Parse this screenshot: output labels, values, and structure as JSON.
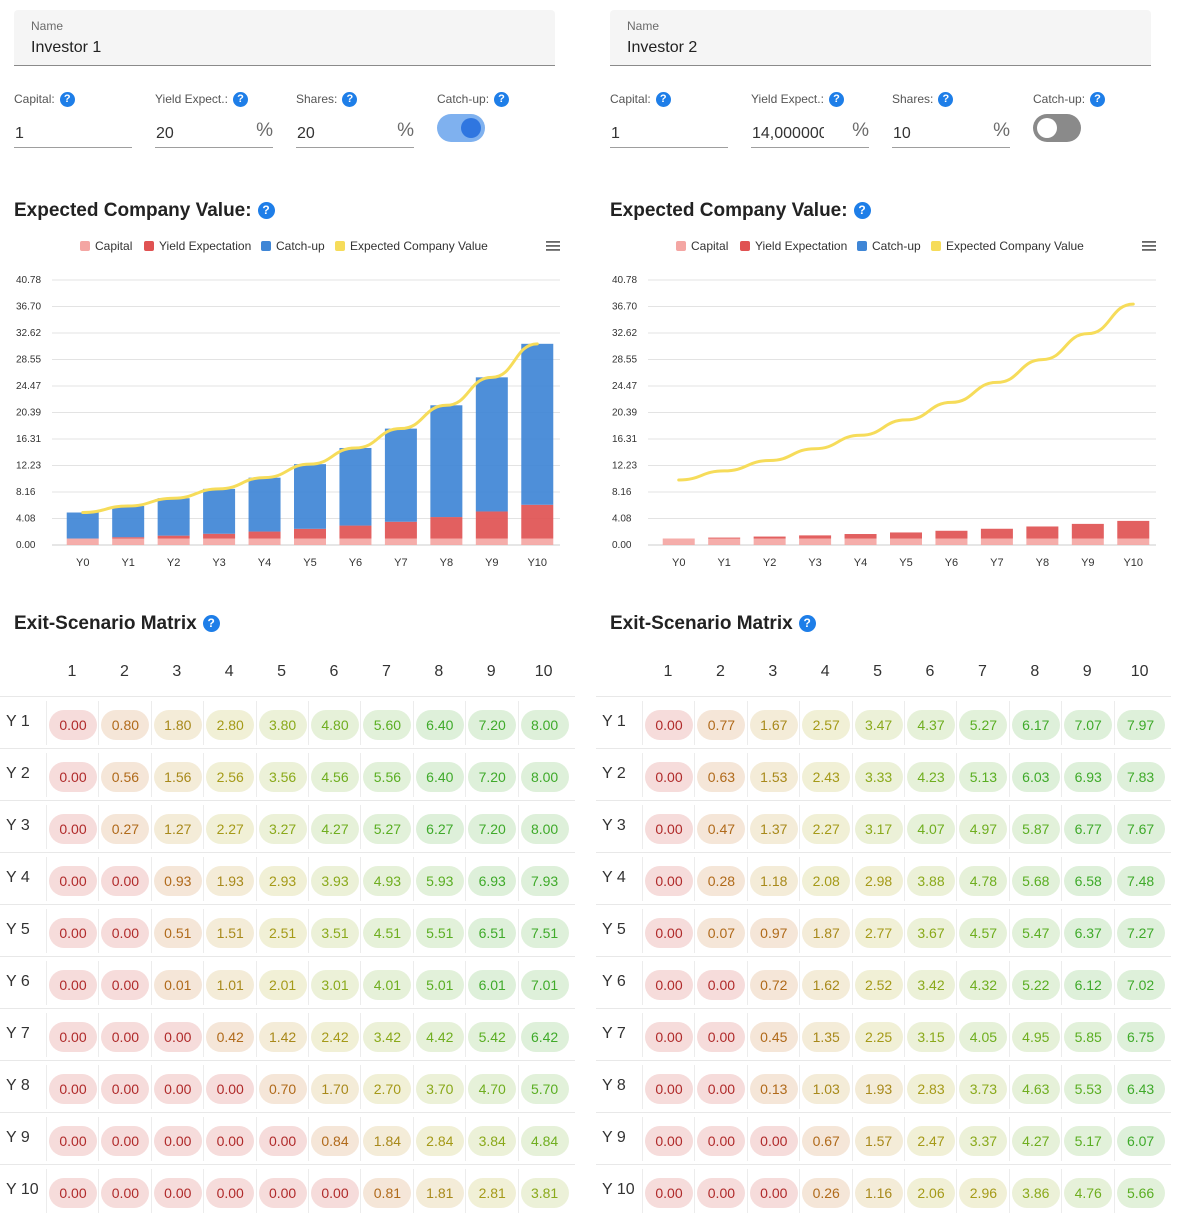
{
  "investors": [
    {
      "name_label": "Name",
      "name": "Investor 1",
      "capital_label": "Capital:",
      "capital": "1",
      "yield_label": "Yield Expect.:",
      "yield": "20",
      "shares_label": "Shares:",
      "shares": "20",
      "percent_symbol": "%",
      "catchup_label": "Catch-up:",
      "catchup_on": true,
      "help_glyph": "?",
      "chart_title": "Expected Company Value:",
      "matrix_title": "Exit-Scenario Matrix",
      "chart_data": {
        "type": "bar",
        "stacked": true,
        "categories": [
          "Y0",
          "Y1",
          "Y2",
          "Y3",
          "Y4",
          "Y5",
          "Y6",
          "Y7",
          "Y8",
          "Y9",
          "Y10"
        ],
        "yticks": [
          "0.00",
          "4.08",
          "8.16",
          "12.23",
          "16.31",
          "20.39",
          "24.47",
          "28.55",
          "32.62",
          "36.70",
          "40.78"
        ],
        "ylim": [
          0,
          40.78
        ],
        "legend": [
          "Capital",
          "Yield Expectation",
          "Catch-up",
          "Expected Company Value"
        ],
        "legend_position": "top",
        "series": [
          {
            "name": "Capital",
            "values": [
              1,
              1,
              1,
              1,
              1,
              1,
              1,
              1,
              1,
              1,
              1
            ]
          },
          {
            "name": "Yield Expectation",
            "values": [
              0,
              0.2,
              0.44,
              0.73,
              1.07,
              1.49,
              1.99,
              2.58,
              3.3,
              4.16,
              5.19
            ]
          },
          {
            "name": "Catch-up",
            "values": [
              4.0,
              4.8,
              5.76,
              6.91,
              8.29,
              9.95,
              11.94,
              14.33,
              17.2,
              20.64,
              24.77
            ]
          },
          {
            "name": "Expected Company Value",
            "type": "line",
            "values": [
              5.0,
              6.0,
              7.2,
              8.64,
              10.37,
              12.44,
              14.93,
              17.92,
              21.5,
              25.8,
              30.96
            ]
          }
        ],
        "colors": {
          "capital": "#f4a6a3",
          "yield": "#e05252",
          "catchup": "#3f86d6",
          "value": "#f6dc5a"
        }
      },
      "matrix": {
        "col_headers": [
          "1",
          "2",
          "3",
          "4",
          "5",
          "6",
          "7",
          "8",
          "9",
          "10"
        ],
        "row_headers": [
          "Y 1",
          "Y 2",
          "Y 3",
          "Y 4",
          "Y 5",
          "Y 6",
          "Y 7",
          "Y 8",
          "Y 9",
          "Y 10"
        ],
        "rows": [
          [
            "0.00",
            "0.80",
            "1.80",
            "2.80",
            "3.80",
            "4.80",
            "5.60",
            "6.40",
            "7.20",
            "8.00"
          ],
          [
            "0.00",
            "0.56",
            "1.56",
            "2.56",
            "3.56",
            "4.56",
            "5.56",
            "6.40",
            "7.20",
            "8.00"
          ],
          [
            "0.00",
            "0.27",
            "1.27",
            "2.27",
            "3.27",
            "4.27",
            "5.27",
            "6.27",
            "7.20",
            "8.00"
          ],
          [
            "0.00",
            "0.00",
            "0.93",
            "1.93",
            "2.93",
            "3.93",
            "4.93",
            "5.93",
            "6.93",
            "7.93"
          ],
          [
            "0.00",
            "0.00",
            "0.51",
            "1.51",
            "2.51",
            "3.51",
            "4.51",
            "5.51",
            "6.51",
            "7.51"
          ],
          [
            "0.00",
            "0.00",
            "0.01",
            "1.01",
            "2.01",
            "3.01",
            "4.01",
            "5.01",
            "6.01",
            "7.01"
          ],
          [
            "0.00",
            "0.00",
            "0.00",
            "0.42",
            "1.42",
            "2.42",
            "3.42",
            "4.42",
            "5.42",
            "6.42"
          ],
          [
            "0.00",
            "0.00",
            "0.00",
            "0.00",
            "0.70",
            "1.70",
            "2.70",
            "3.70",
            "4.70",
            "5.70"
          ],
          [
            "0.00",
            "0.00",
            "0.00",
            "0.00",
            "0.00",
            "0.84",
            "1.84",
            "2.84",
            "3.84",
            "4.84"
          ],
          [
            "0.00",
            "0.00",
            "0.00",
            "0.00",
            "0.00",
            "0.00",
            "0.81",
            "1.81",
            "2.81",
            "3.81"
          ]
        ]
      }
    },
    {
      "name_label": "Name",
      "name": "Investor 2",
      "capital_label": "Capital:",
      "capital": "1",
      "yield_label": "Yield Expect.:",
      "yield": "14,000000",
      "shares_label": "Shares:",
      "shares": "10",
      "percent_symbol": "%",
      "catchup_label": "Catch-up:",
      "catchup_on": false,
      "help_glyph": "?",
      "chart_title": "Expected Company Value:",
      "matrix_title": "Exit-Scenario Matrix",
      "chart_data": {
        "type": "bar",
        "stacked": true,
        "categories": [
          "Y0",
          "Y1",
          "Y2",
          "Y3",
          "Y4",
          "Y5",
          "Y6",
          "Y7",
          "Y8",
          "Y9",
          "Y10"
        ],
        "yticks": [
          "0.00",
          "4.08",
          "8.16",
          "12.23",
          "16.31",
          "20.39",
          "24.47",
          "28.55",
          "32.62",
          "36.70",
          "40.78"
        ],
        "ylim": [
          0,
          40.78
        ],
        "legend": [
          "Capital",
          "Yield Expectation",
          "Catch-up",
          "Expected Company Value"
        ],
        "legend_position": "top",
        "series": [
          {
            "name": "Capital",
            "values": [
              1,
              1,
              1,
              1,
              1,
              1,
              1,
              1,
              1,
              1,
              1
            ]
          },
          {
            "name": "Yield Expectation",
            "values": [
              0,
              0.14,
              0.3,
              0.48,
              0.69,
              0.93,
              1.19,
              1.5,
              1.85,
              2.25,
              2.71
            ]
          },
          {
            "name": "Catch-up",
            "values": [
              0,
              0,
              0,
              0,
              0,
              0,
              0,
              0,
              0,
              0,
              0
            ]
          },
          {
            "name": "Expected Company Value",
            "type": "line",
            "values": [
              10.0,
              11.4,
              13.0,
              14.81,
              16.89,
              19.25,
              21.95,
              25.02,
              28.53,
              32.52,
              37.07
            ]
          }
        ],
        "colors": {
          "capital": "#f4a6a3",
          "yield": "#e05252",
          "catchup": "#3f86d6",
          "value": "#f6dc5a"
        }
      },
      "matrix": {
        "col_headers": [
          "1",
          "2",
          "3",
          "4",
          "5",
          "6",
          "7",
          "8",
          "9",
          "10"
        ],
        "row_headers": [
          "Y 1",
          "Y 2",
          "Y 3",
          "Y 4",
          "Y 5",
          "Y 6",
          "Y 7",
          "Y 8",
          "Y 9",
          "Y 10"
        ],
        "rows": [
          [
            "0.00",
            "0.77",
            "1.67",
            "2.57",
            "3.47",
            "4.37",
            "5.27",
            "6.17",
            "7.07",
            "7.97"
          ],
          [
            "0.00",
            "0.63",
            "1.53",
            "2.43",
            "3.33",
            "4.23",
            "5.13",
            "6.03",
            "6.93",
            "7.83"
          ],
          [
            "0.00",
            "0.47",
            "1.37",
            "2.27",
            "3.17",
            "4.07",
            "4.97",
            "5.87",
            "6.77",
            "7.67"
          ],
          [
            "0.00",
            "0.28",
            "1.18",
            "2.08",
            "2.98",
            "3.88",
            "4.78",
            "5.68",
            "6.58",
            "7.48"
          ],
          [
            "0.00",
            "0.07",
            "0.97",
            "1.87",
            "2.77",
            "3.67",
            "4.57",
            "5.47",
            "6.37",
            "7.27"
          ],
          [
            "0.00",
            "0.00",
            "0.72",
            "1.62",
            "2.52",
            "3.42",
            "4.32",
            "5.22",
            "6.12",
            "7.02"
          ],
          [
            "0.00",
            "0.00",
            "0.45",
            "1.35",
            "2.25",
            "3.15",
            "4.05",
            "4.95",
            "5.85",
            "6.75"
          ],
          [
            "0.00",
            "0.00",
            "0.13",
            "1.03",
            "1.93",
            "2.83",
            "3.73",
            "4.63",
            "5.53",
            "6.43"
          ],
          [
            "0.00",
            "0.00",
            "0.00",
            "0.67",
            "1.57",
            "2.47",
            "3.37",
            "4.27",
            "5.17",
            "6.07"
          ],
          [
            "0.00",
            "0.00",
            "0.00",
            "0.26",
            "1.16",
            "2.06",
            "2.96",
            "3.86",
            "4.76",
            "5.66"
          ]
        ]
      }
    }
  ],
  "menu_icon": "hamburger-menu-icon"
}
